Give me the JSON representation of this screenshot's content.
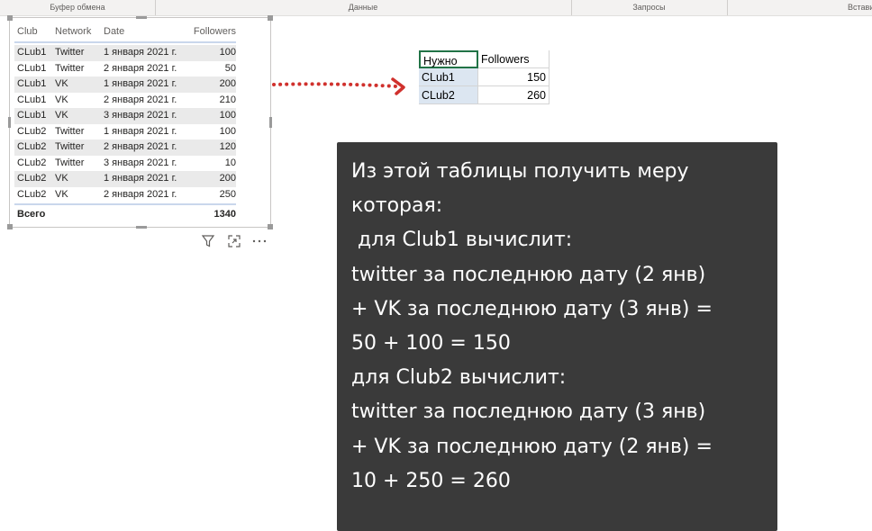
{
  "ribbon": {
    "groups": [
      "Буфер обмена",
      "Данные",
      "Запросы",
      "Вставить"
    ]
  },
  "pbi_table": {
    "headers": [
      "Club",
      "Network",
      "Date",
      "Followers"
    ],
    "rows": [
      [
        "CLub1",
        "Twitter",
        "1 января 2021 г.",
        "100"
      ],
      [
        "CLub1",
        "Twitter",
        "2 января 2021 г.",
        "50"
      ],
      [
        "CLub1",
        "VK",
        "1 января 2021 г.",
        "200"
      ],
      [
        "CLub1",
        "VK",
        "2 января 2021 г.",
        "210"
      ],
      [
        "CLub1",
        "VK",
        "3 января 2021 г.",
        "100"
      ],
      [
        "CLub2",
        "Twitter",
        "1 января 2021 г.",
        "100"
      ],
      [
        "CLub2",
        "Twitter",
        "2 января 2021 г.",
        "120"
      ],
      [
        "CLub2",
        "Twitter",
        "3 января 2021 г.",
        "10"
      ],
      [
        "CLub2",
        "VK",
        "1 января 2021 г.",
        "200"
      ],
      [
        "CLub2",
        "VK",
        "2 января 2021 г.",
        "250"
      ]
    ],
    "total_label": "Всего",
    "total_value": "1340"
  },
  "visual_icons": [
    "filter-icon",
    "focus-mode-icon",
    "more-options-icon"
  ],
  "excel": {
    "header": [
      "Нужно",
      "Followers"
    ],
    "rows": [
      [
        "CLub1",
        "150"
      ],
      [
        "CLub2",
        "260"
      ]
    ]
  },
  "note": {
    "lines": [
      "Из этой таблицы получить меру",
      "которая:",
      " для Club1 вычислит:",
      "twitter за последнюю дату (2 янв)",
      "+ VK за последнюю дату (3 янв) =",
      "50 + 100 = 150",
      "для Club2 вычислит:",
      "twitter за последнюю дату (3 янв)",
      "+ VK за последнюю дату (2 янв) =",
      "10 + 250 = 260"
    ]
  },
  "colors": {
    "arrow": "#d0312d",
    "note_bg": "#3a3a3a",
    "excel_selection": "#217346",
    "excel_highlight": "#dce6f1"
  }
}
